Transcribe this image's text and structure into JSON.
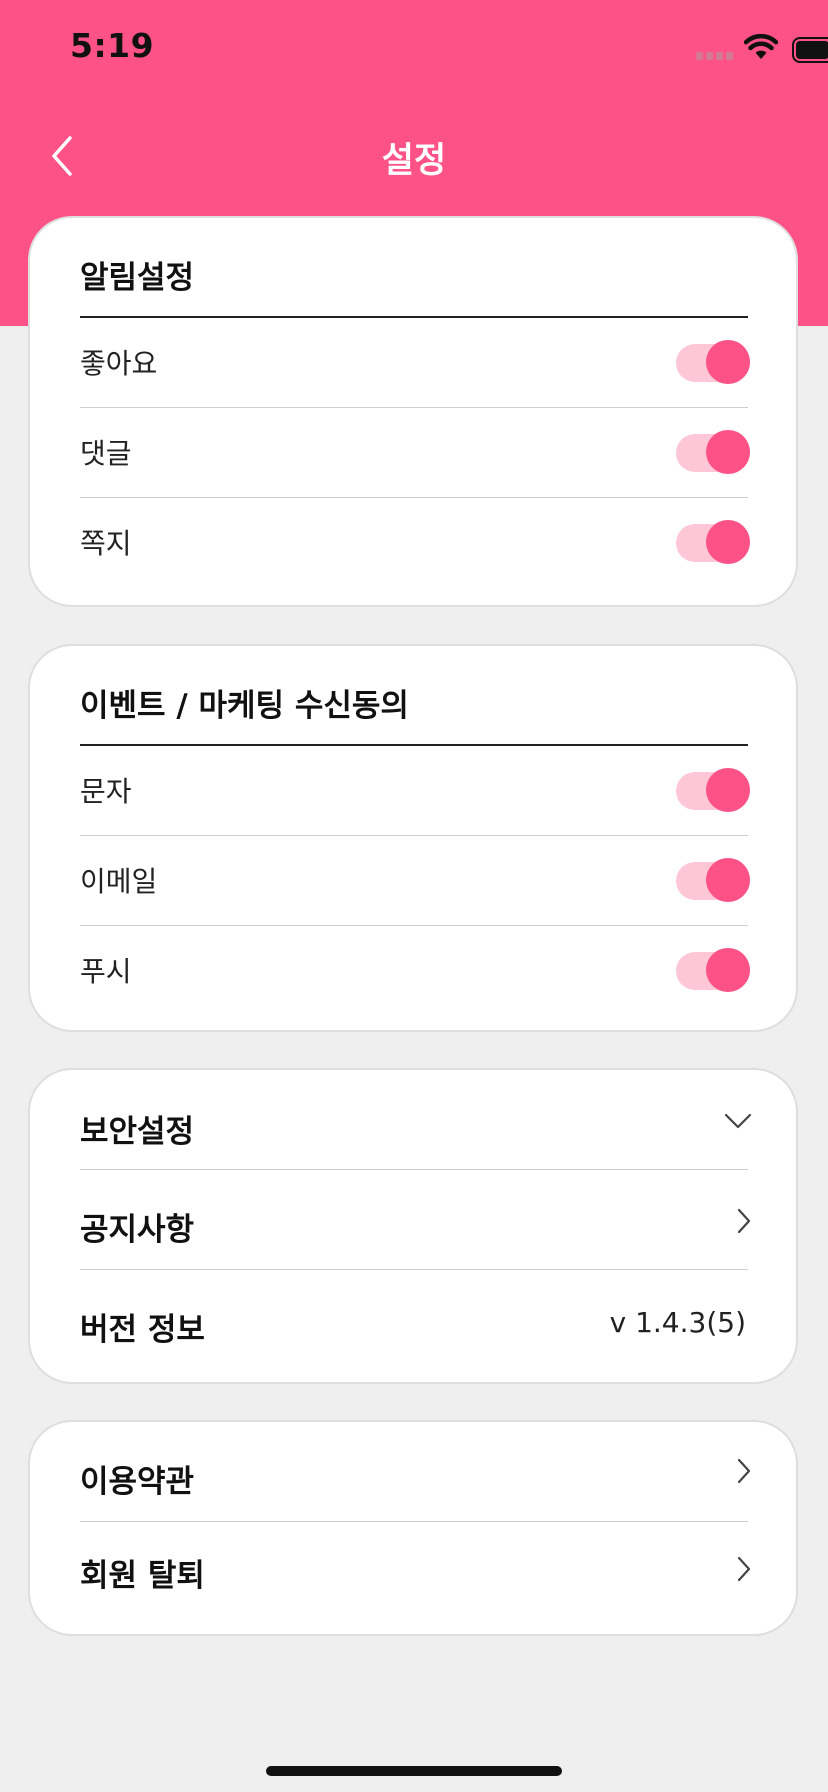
{
  "status_bar": {
    "time": "5:19"
  },
  "header": {
    "title": "설정"
  },
  "notification_settings": {
    "title": "알림설정",
    "items": [
      {
        "label": "좋아요",
        "enabled": true
      },
      {
        "label": "댓글",
        "enabled": true
      },
      {
        "label": "쪽지",
        "enabled": true
      }
    ]
  },
  "marketing_consent": {
    "title": "이벤트 / 마케팅 수신동의",
    "items": [
      {
        "label": "문자",
        "enabled": true
      },
      {
        "label": "이메일",
        "enabled": true
      },
      {
        "label": "푸시",
        "enabled": true
      }
    ]
  },
  "app_menu": {
    "security_label": "보안설정",
    "notice_label": "공지사항",
    "version_label": "버전 정보",
    "version_value": "v 1.4.3(5)"
  },
  "account_menu": {
    "terms_label": "이용약관",
    "withdraw_label": "회원 탈퇴"
  },
  "colors": {
    "accent": "#fd5287",
    "toggle_track": "#fdc7d8",
    "background": "#efefef"
  }
}
